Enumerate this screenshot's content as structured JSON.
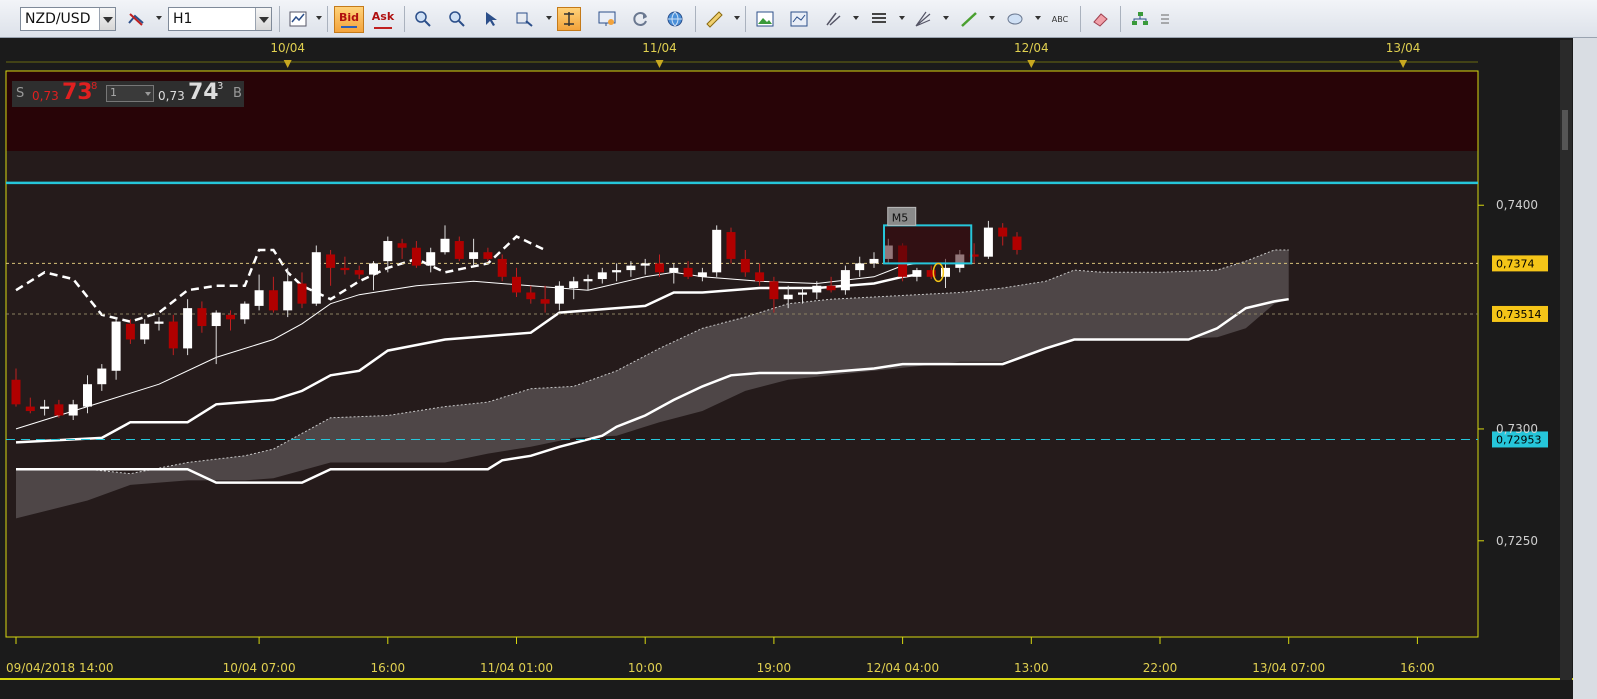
{
  "toolbar": {
    "symbol": "NZD/USD",
    "timeframe": "H1",
    "bid_label": "Bid",
    "ask_label": "Ask",
    "text_tool_label": "ABC"
  },
  "trade_panel": {
    "sell_letter": "S",
    "sell_prefix": "0,73",
    "sell_big": "73",
    "sell_sup": "8",
    "lot": "1",
    "buy_prefix": "0,73",
    "buy_big": "74",
    "buy_sup": "3",
    "buy_letter": "B"
  },
  "chart_data": {
    "type": "candlestick",
    "symbol": "NZD/USD",
    "timeframe": "H1",
    "y_range": [
      0.7207,
      0.746
    ],
    "y_ticks": [
      {
        "value": 0.74,
        "label": "0,7400"
      },
      {
        "value": 0.73,
        "label": "0,7300"
      },
      {
        "value": 0.725,
        "label": "0,7250"
      }
    ],
    "top_date_labels": [
      {
        "x_index": 19,
        "label": "10/04"
      },
      {
        "x_index": 45,
        "label": "11/04"
      },
      {
        "x_index": 71,
        "label": "12/04"
      },
      {
        "x_index": 97,
        "label": "13/04"
      }
    ],
    "bottom_time_labels": [
      {
        "x_index": 0,
        "label": "09/04/2018 14:00"
      },
      {
        "x_index": 17,
        "label": "10/04 07:00"
      },
      {
        "x_index": 26,
        "label": "16:00"
      },
      {
        "x_index": 35,
        "label": "11/04 01:00"
      },
      {
        "x_index": 44,
        "label": "10:00"
      },
      {
        "x_index": 53,
        "label": "19:00"
      },
      {
        "x_index": 62,
        "label": "12/04 04:00"
      },
      {
        "x_index": 71,
        "label": "13:00"
      },
      {
        "x_index": 80,
        "label": "22:00"
      },
      {
        "x_index": 89,
        "label": "13/04 07:00"
      },
      {
        "x_index": 98,
        "label": "16:00"
      }
    ],
    "price_lines": [
      {
        "name": "resistance",
        "value": 0.741,
        "color": "#26c6da",
        "style": "solid"
      },
      {
        "name": "current-price",
        "value": 0.7374,
        "color": "#d8c27a",
        "style": "dotted",
        "label": "0,7374",
        "label_color": "#f5c518"
      },
      {
        "name": "level-0.73514",
        "value": 0.73514,
        "color": "#8a8060",
        "style": "dotted",
        "label": "0,73514",
        "label_color": "#f5c518"
      },
      {
        "name": "support",
        "value": 0.72953,
        "color": "#26c6da",
        "style": "dashed",
        "label": "0,72953",
        "label_color": "#26c6da"
      }
    ],
    "candles": [
      [
        0.7322,
        0.7327,
        0.731,
        0.7311
      ],
      [
        0.731,
        0.7314,
        0.7307,
        0.7308
      ],
      [
        0.7309,
        0.7313,
        0.7306,
        0.731
      ],
      [
        0.7311,
        0.7313,
        0.7305,
        0.7306
      ],
      [
        0.7306,
        0.7313,
        0.7304,
        0.7311
      ],
      [
        0.731,
        0.7324,
        0.7307,
        0.732
      ],
      [
        0.732,
        0.7329,
        0.7317,
        0.7327
      ],
      [
        0.7326,
        0.735,
        0.7322,
        0.7348
      ],
      [
        0.7347,
        0.7349,
        0.7338,
        0.734
      ],
      [
        0.734,
        0.7349,
        0.7338,
        0.7347
      ],
      [
        0.7347,
        0.735,
        0.7344,
        0.7348
      ],
      [
        0.7348,
        0.7351,
        0.7333,
        0.7336
      ],
      [
        0.7336,
        0.7358,
        0.7333,
        0.7354
      ],
      [
        0.7354,
        0.7357,
        0.7343,
        0.7346
      ],
      [
        0.7346,
        0.7353,
        0.7329,
        0.7352
      ],
      [
        0.7351,
        0.7353,
        0.7344,
        0.7349
      ],
      [
        0.7349,
        0.7357,
        0.7347,
        0.7356
      ],
      [
        0.7355,
        0.7369,
        0.7353,
        0.7362
      ],
      [
        0.7362,
        0.7368,
        0.7352,
        0.7353
      ],
      [
        0.7353,
        0.7372,
        0.735,
        0.7366
      ],
      [
        0.7365,
        0.737,
        0.7354,
        0.7356
      ],
      [
        0.7356,
        0.7382,
        0.7355,
        0.7379
      ],
      [
        0.7378,
        0.738,
        0.7364,
        0.7372
      ],
      [
        0.7372,
        0.7377,
        0.7369,
        0.7371
      ],
      [
        0.7371,
        0.7373,
        0.7367,
        0.7369
      ],
      [
        0.7369,
        0.7375,
        0.7362,
        0.7374
      ],
      [
        0.7375,
        0.7386,
        0.737,
        0.7384
      ],
      [
        0.7383,
        0.7385,
        0.7376,
        0.7381
      ],
      [
        0.7381,
        0.7384,
        0.7372,
        0.7373
      ],
      [
        0.7373,
        0.7381,
        0.737,
        0.7379
      ],
      [
        0.7379,
        0.7391,
        0.7378,
        0.7385
      ],
      [
        0.7384,
        0.7386,
        0.7375,
        0.7376
      ],
      [
        0.7376,
        0.7385,
        0.7373,
        0.7379
      ],
      [
        0.7379,
        0.7381,
        0.7375,
        0.7376
      ],
      [
        0.7376,
        0.7378,
        0.7366,
        0.7368
      ],
      [
        0.7368,
        0.7372,
        0.7359,
        0.7361
      ],
      [
        0.7361,
        0.7364,
        0.7356,
        0.7358
      ],
      [
        0.7358,
        0.7364,
        0.7352,
        0.7356
      ],
      [
        0.7356,
        0.7366,
        0.7353,
        0.7364
      ],
      [
        0.7363,
        0.7368,
        0.7358,
        0.7366
      ],
      [
        0.7366,
        0.7369,
        0.7362,
        0.7367
      ],
      [
        0.7367,
        0.7372,
        0.7365,
        0.737
      ],
      [
        0.737,
        0.7374,
        0.7366,
        0.7371
      ],
      [
        0.7371,
        0.7375,
        0.7368,
        0.7373
      ],
      [
        0.7373,
        0.7376,
        0.7369,
        0.7374
      ],
      [
        0.7374,
        0.7378,
        0.7368,
        0.737
      ],
      [
        0.737,
        0.7374,
        0.7365,
        0.7372
      ],
      [
        0.7372,
        0.7375,
        0.7367,
        0.7368
      ],
      [
        0.7368,
        0.7372,
        0.7366,
        0.737
      ],
      [
        0.737,
        0.7391,
        0.7368,
        0.7389
      ],
      [
        0.7388,
        0.739,
        0.7374,
        0.7376
      ],
      [
        0.7376,
        0.738,
        0.7368,
        0.737
      ],
      [
        0.737,
        0.7374,
        0.7364,
        0.7366
      ],
      [
        0.7366,
        0.7368,
        0.7352,
        0.7358
      ],
      [
        0.7358,
        0.7364,
        0.7354,
        0.736
      ],
      [
        0.736,
        0.7363,
        0.7356,
        0.7361
      ],
      [
        0.7361,
        0.7366,
        0.7358,
        0.7364
      ],
      [
        0.7364,
        0.7368,
        0.7361,
        0.7362
      ],
      [
        0.7362,
        0.7373,
        0.736,
        0.7371
      ],
      [
        0.7371,
        0.7377,
        0.7368,
        0.7374
      ],
      [
        0.7374,
        0.7379,
        0.7372,
        0.7376
      ],
      [
        0.7376,
        0.7385,
        0.7374,
        0.7382
      ],
      [
        0.7382,
        0.7383,
        0.7366,
        0.7368
      ],
      [
        0.7368,
        0.7372,
        0.7366,
        0.7371
      ],
      [
        0.7371,
        0.7373,
        0.7367,
        0.7368
      ],
      [
        0.7368,
        0.7376,
        0.7363,
        0.7372
      ],
      [
        0.7372,
        0.738,
        0.737,
        0.7378
      ],
      [
        0.7378,
        0.7383,
        0.7374,
        0.7377
      ],
      [
        0.7377,
        0.7393,
        0.7376,
        0.739
      ],
      [
        0.739,
        0.7392,
        0.7382,
        0.7386
      ],
      [
        0.7386,
        0.7388,
        0.7378,
        0.738
      ]
    ],
    "kumo_upper": [
      [
        0,
        0.7282
      ],
      [
        5,
        0.7282
      ],
      [
        8,
        0.728
      ],
      [
        12,
        0.7285
      ],
      [
        16,
        0.7288
      ],
      [
        18,
        0.7291
      ],
      [
        22,
        0.7305
      ],
      [
        26,
        0.7306
      ],
      [
        30,
        0.731
      ],
      [
        33,
        0.7312
      ],
      [
        36,
        0.7318
      ],
      [
        39,
        0.7319
      ],
      [
        42,
        0.7326
      ],
      [
        45,
        0.7336
      ],
      [
        48,
        0.7345
      ],
      [
        51,
        0.735
      ],
      [
        54,
        0.7356
      ],
      [
        57,
        0.7358
      ],
      [
        60,
        0.7359
      ],
      [
        63,
        0.736
      ],
      [
        66,
        0.7361
      ],
      [
        69,
        0.7363
      ],
      [
        72,
        0.7366
      ],
      [
        74,
        0.7371
      ],
      [
        76,
        0.737
      ],
      [
        80,
        0.737
      ],
      [
        84,
        0.7371
      ],
      [
        86,
        0.7375
      ],
      [
        88,
        0.738
      ],
      [
        89,
        0.738
      ]
    ],
    "kumo_lower": [
      [
        0,
        0.726
      ],
      [
        5,
        0.7268
      ],
      [
        8,
        0.7275
      ],
      [
        12,
        0.7277
      ],
      [
        16,
        0.7277
      ],
      [
        18,
        0.7278
      ],
      [
        22,
        0.7285
      ],
      [
        26,
        0.7285
      ],
      [
        30,
        0.7285
      ],
      [
        33,
        0.7289
      ],
      [
        36,
        0.7292
      ],
      [
        39,
        0.7296
      ],
      [
        42,
        0.7297
      ],
      [
        45,
        0.7303
      ],
      [
        48,
        0.7308
      ],
      [
        51,
        0.7317
      ],
      [
        54,
        0.7322
      ],
      [
        57,
        0.7324
      ],
      [
        60,
        0.7326
      ],
      [
        63,
        0.7328
      ],
      [
        66,
        0.733
      ],
      [
        69,
        0.733
      ],
      [
        72,
        0.7336
      ],
      [
        74,
        0.734
      ],
      [
        76,
        0.734
      ],
      [
        80,
        0.734
      ],
      [
        84,
        0.7341
      ],
      [
        86,
        0.7345
      ],
      [
        88,
        0.7356
      ],
      [
        89,
        0.7358
      ]
    ],
    "line_a": [
      [
        0,
        0.7282
      ],
      [
        12,
        0.7282
      ],
      [
        14,
        0.7276
      ],
      [
        20,
        0.7276
      ],
      [
        22,
        0.7282
      ],
      [
        33,
        0.7282
      ],
      [
        34,
        0.7286
      ],
      [
        36,
        0.7288
      ],
      [
        38,
        0.7292
      ],
      [
        41,
        0.7297
      ],
      [
        42,
        0.7301
      ],
      [
        44,
        0.7306
      ],
      [
        46,
        0.7313
      ],
      [
        48,
        0.7319
      ],
      [
        50,
        0.7324
      ],
      [
        52,
        0.7325
      ],
      [
        56,
        0.7325
      ],
      [
        60,
        0.7327
      ],
      [
        62,
        0.7329
      ],
      [
        69,
        0.7329
      ],
      [
        72,
        0.7336
      ],
      [
        74,
        0.734
      ],
      [
        82,
        0.734
      ],
      [
        84,
        0.7345
      ],
      [
        86,
        0.7354
      ],
      [
        88,
        0.7357
      ],
      [
        89,
        0.7358
      ]
    ],
    "line_b": [
      [
        0,
        0.7294
      ],
      [
        6,
        0.7296
      ],
      [
        8,
        0.7303
      ],
      [
        12,
        0.7303
      ],
      [
        14,
        0.7311
      ],
      [
        18,
        0.7313
      ],
      [
        20,
        0.7317
      ],
      [
        22,
        0.7324
      ],
      [
        24,
        0.7326
      ],
      [
        26,
        0.7335
      ],
      [
        30,
        0.734
      ],
      [
        32,
        0.7341
      ],
      [
        36,
        0.7343
      ],
      [
        38,
        0.7352
      ],
      [
        44,
        0.7355
      ],
      [
        46,
        0.7361
      ],
      [
        48,
        0.7361
      ],
      [
        52,
        0.7363
      ],
      [
        56,
        0.7363
      ],
      [
        60,
        0.7365
      ],
      [
        62,
        0.7368
      ],
      [
        63,
        0.7369
      ]
    ],
    "line_c": [
      [
        0,
        0.73
      ],
      [
        6,
        0.7312
      ],
      [
        10,
        0.732
      ],
      [
        14,
        0.7332
      ],
      [
        18,
        0.734
      ],
      [
        20,
        0.7347
      ],
      [
        22,
        0.7356
      ],
      [
        24,
        0.736
      ],
      [
        28,
        0.7364
      ],
      [
        32,
        0.7366
      ],
      [
        36,
        0.7364
      ],
      [
        40,
        0.7362
      ],
      [
        44,
        0.7368
      ],
      [
        46,
        0.737
      ],
      [
        48,
        0.7368
      ],
      [
        52,
        0.7366
      ],
      [
        56,
        0.7365
      ],
      [
        60,
        0.7368
      ],
      [
        62,
        0.7373
      ],
      [
        63,
        0.7374
      ]
    ],
    "chikou": [
      [
        0,
        0.7362
      ],
      [
        2,
        0.737
      ],
      [
        4,
        0.7367
      ],
      [
        6,
        0.7351
      ],
      [
        8,
        0.7348
      ],
      [
        10,
        0.7352
      ],
      [
        12,
        0.7362
      ],
      [
        14,
        0.7364
      ],
      [
        16,
        0.7364
      ],
      [
        17,
        0.738
      ],
      [
        18,
        0.738
      ],
      [
        19,
        0.737
      ],
      [
        20,
        0.7364
      ],
      [
        22,
        0.7358
      ],
      [
        24,
        0.7366
      ],
      [
        26,
        0.7372
      ],
      [
        28,
        0.7376
      ],
      [
        30,
        0.737
      ],
      [
        33,
        0.7374
      ],
      [
        34,
        0.738
      ],
      [
        35,
        0.7386
      ],
      [
        37,
        0.738
      ]
    ],
    "annotations": [
      {
        "type": "box",
        "x_from": 60.7,
        "x_to": 66.8,
        "y_from": 0.7374,
        "y_to": 0.7391,
        "color": "#26c6da"
      },
      {
        "type": "label",
        "x_index": 61.1,
        "value": 0.7391,
        "text": "M5"
      },
      {
        "type": "ellipse",
        "x_index": 64.5,
        "value": 0.737,
        "color": "#f5c518"
      }
    ]
  }
}
